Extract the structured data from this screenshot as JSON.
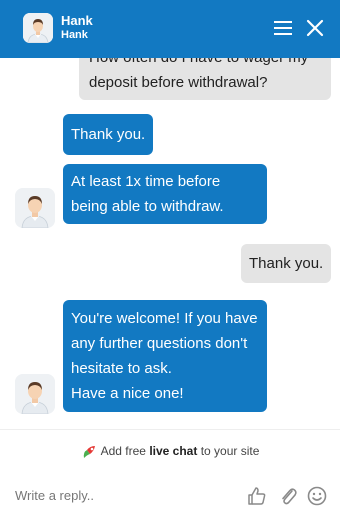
{
  "header": {
    "agent_name": "Hank",
    "agent_subtitle": "Hank",
    "menu_icon": "hamburger-menu-icon",
    "close_icon": "close-icon"
  },
  "messages": [
    {
      "sender": "user",
      "lines": [
        "How often do I have to wager my",
        "deposit before withdrawal?"
      ]
    },
    {
      "sender": "agent",
      "lines": [
        "Thank you."
      ]
    },
    {
      "sender": "agent",
      "lines": [
        "At least 1x time before",
        "being able to withdraw."
      ]
    },
    {
      "sender": "user",
      "lines": [
        "Thank you."
      ]
    },
    {
      "sender": "agent",
      "lines": [
        "You're welcome! If you have",
        "any further questions don't",
        "hesitate to ask.",
        "Have a nice one!"
      ]
    }
  ],
  "branding": {
    "prefix": "Add free",
    "bold": "live chat",
    "suffix": "to your site"
  },
  "composer": {
    "placeholder": "Write a reply..",
    "icons": [
      "thumbs-up-icon",
      "paperclip-icon",
      "smiley-icon"
    ]
  },
  "colors": {
    "brand": "#1279c2",
    "user_bubble": "#e4e4e4"
  }
}
